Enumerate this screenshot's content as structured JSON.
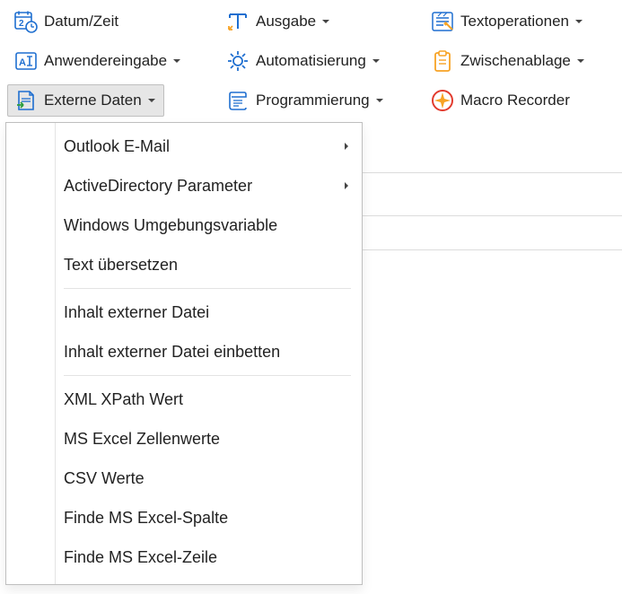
{
  "ribbon": {
    "row1": {
      "date_time": {
        "label": "Datum/Zeit"
      },
      "output": {
        "label": "Ausgabe"
      },
      "text_ops": {
        "label": "Textoperationen"
      }
    },
    "row2": {
      "user_input": {
        "label": "Anwendereingabe"
      },
      "automation": {
        "label": "Automatisierung"
      },
      "clipboard": {
        "label": "Zwischenablage"
      }
    },
    "row3": {
      "external_data": {
        "label": "Externe Daten"
      },
      "programming": {
        "label": "Programmierung"
      },
      "macro_rec": {
        "label": "Macro Recorder"
      }
    }
  },
  "menu": {
    "outlook": "Outlook E-Mail",
    "activedir": "ActiveDirectory Parameter",
    "env": "Windows Umgebungsvariable",
    "translate": "Text übersetzen",
    "ext_file": "Inhalt externer Datei",
    "ext_file_embed": "Inhalt externer Datei einbetten",
    "xml_xpath": "XML XPath Wert",
    "excel_cells": "MS Excel Zellenwerte",
    "csv": "CSV Werte",
    "excel_col": "Finde MS Excel-Spalte",
    "excel_row": "Finde MS Excel-Zeile"
  },
  "colors": {
    "accent_blue": "#1f6fd0",
    "accent_orange": "#f7a325",
    "accent_red": "#e23b2e",
    "active_bg": "#e6e6e6",
    "border": "#bfbfbf"
  }
}
